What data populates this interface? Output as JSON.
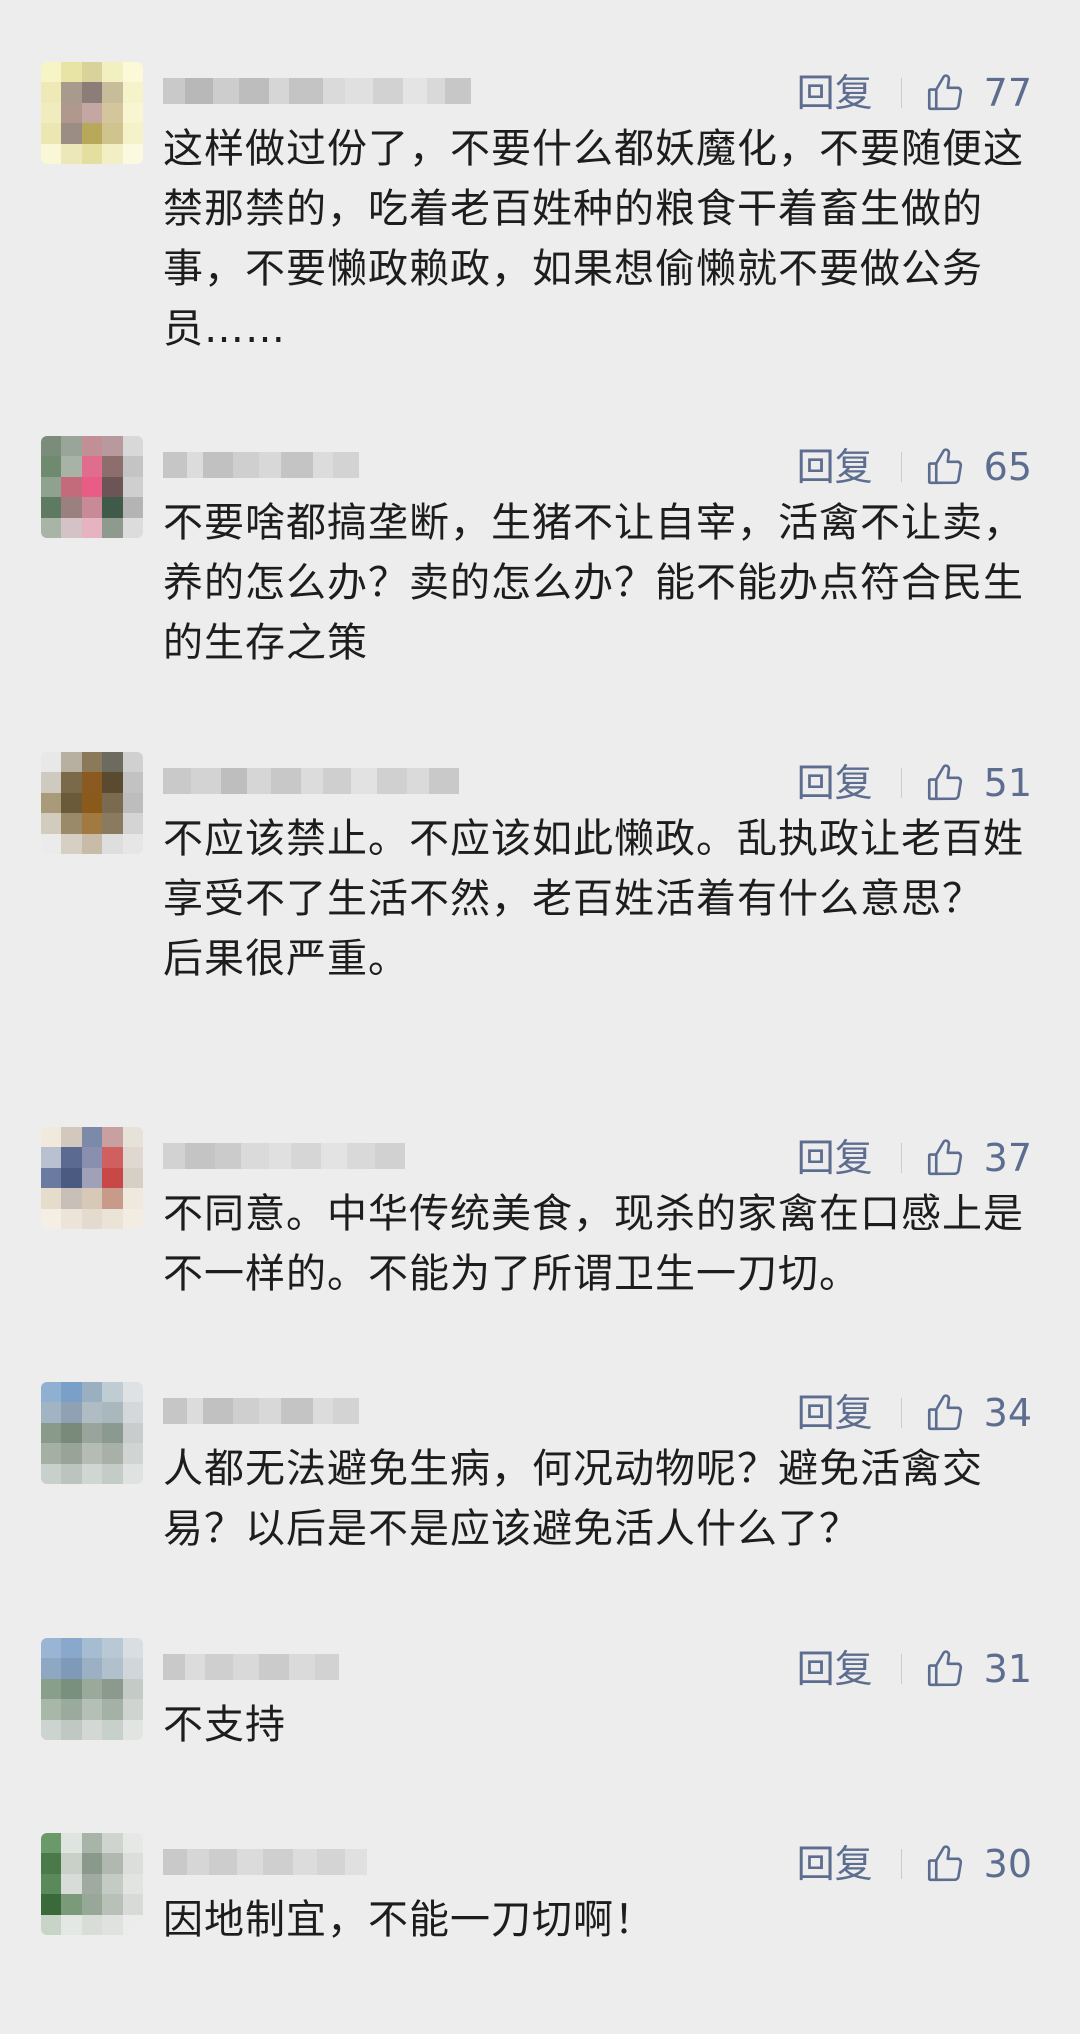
{
  "comments": [
    {
      "reply_label": "回复",
      "likes": "77",
      "text": "这样做过份了，不要什么都妖魔化，不要随便这禁那禁的，吃着老百姓种的粮食干着畜生做的事，不要懒政赖政，如果想偷懒就不要做公务员……"
    },
    {
      "reply_label": "回复",
      "likes": "65",
      "text": "不要啥都搞垄断，生猪不让自宰，活禽不让卖，养的怎么办？卖的怎么办？能不能办点符合民生的生存之策"
    },
    {
      "reply_label": "回复",
      "likes": "51",
      "text": "不应该禁止。不应该如此懒政。乱执政让老百姓享受不了生活不然，老百姓活着有什么意思？\n后果很严重。"
    },
    {
      "reply_label": "回复",
      "likes": "37",
      "text": "不同意。中华传统美食，现杀的家禽在口感上是不一样的。不能为了所谓卫生一刀切。"
    },
    {
      "reply_label": "回复",
      "likes": "34",
      "text": "人都无法避免生病，何况动物呢？避免活禽交易？以后是不是应该避免活人什么了？"
    },
    {
      "reply_label": "回复",
      "likes": "31",
      "text": "不支持"
    },
    {
      "reply_label": "回复",
      "likes": "30",
      "text": "因地制宜，不能一刀切啊！"
    }
  ],
  "icons": {
    "like": "thumbs-up-icon"
  },
  "colors": {
    "background": "#ededed",
    "action_text": "#5d6d8f",
    "body_text": "#1d1d1d"
  }
}
